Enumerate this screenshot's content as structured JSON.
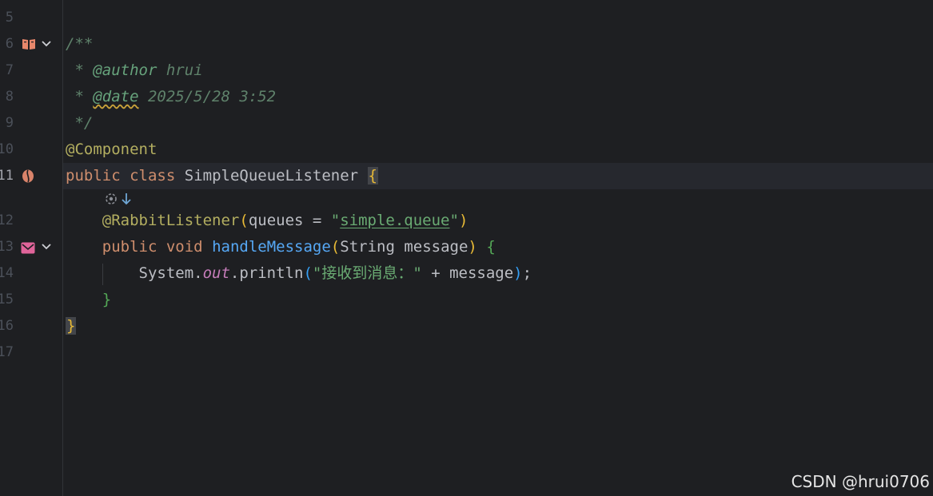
{
  "editor": {
    "line_numbers": [
      "5",
      "6",
      "7",
      "8",
      "9",
      "10",
      "11",
      "12",
      "13",
      "14",
      "15",
      "16",
      "17"
    ],
    "comment_open": "/**",
    "author_star": " * ",
    "author_tag": "@author",
    "author_value": " hrui",
    "date_star": " * ",
    "date_tag": "@date",
    "date_value": " 2025/5/28 3:52",
    "comment_close": " */",
    "annotation_component": "@Component",
    "kw_public": "public",
    "kw_class": "class",
    "class_name": "SimpleQueueListener",
    "open_brace": "{",
    "annotation_rabbit": "@RabbitListener",
    "paren_open": "(",
    "param_queues": "queues = ",
    "quote": "\"",
    "queue_name": "simple.queue",
    "paren_close": ")",
    "kw_void": "void",
    "method_name": "handleMessage",
    "param_type": "String message",
    "system": "System.",
    "out": "out",
    "println": ".println",
    "string_literal": "\"接收到消息：\"",
    "concat": " + message",
    "semicolon": ";",
    "close_brace": "}"
  },
  "gutter_icons": {
    "line6": "book-reader-mode-icon",
    "line11": "bean-icon",
    "line13": "mail-listener-icon",
    "fold": "chevron-down-icon",
    "hint": "rabbitmq-hint-icon"
  },
  "watermark": "CSDN @hrui0706",
  "colors": {
    "background": "#1e1f22",
    "keyword": "#cf8e6d",
    "annotation": "#b3ae60",
    "method": "#56a8f5",
    "string": "#6aab73",
    "doc_comment": "#5f826b"
  }
}
